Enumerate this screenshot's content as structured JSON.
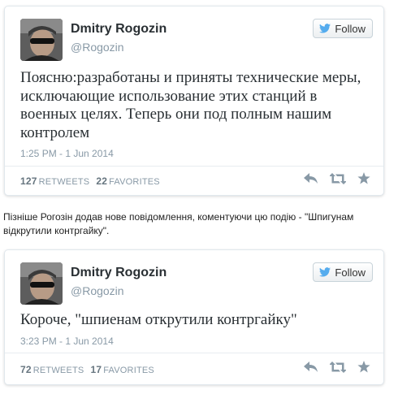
{
  "colors": {
    "brand_blue": "#55acee",
    "secondary_text": "#8899a6",
    "primary_text": "#292f33",
    "action_icon": "#8899a6"
  },
  "icons": [
    "avatar-photo",
    "twitter-bird-icon",
    "reply-icon",
    "retweet-icon",
    "favorite-star-icon"
  ],
  "tweets": [
    {
      "author_name": "Dmitry Rogozin",
      "author_handle": "@Rogozin",
      "follow_label": "Follow",
      "text": "Поясню:разработаны и приняты технические меры, исключающие использование этих станций в военных целях. Теперь они под полным нашим контролем",
      "timestamp": "1:25 PM - 1 Jun 2014",
      "retweets_count": "127",
      "retweets_label": "RETWEETS",
      "favorites_count": "22",
      "favorites_label": "FAVORITES"
    },
    {
      "author_name": "Dmitry Rogozin",
      "author_handle": "@Rogozin",
      "follow_label": "Follow",
      "text": "Короче, \"шпиенам открутили контргайку\"",
      "timestamp": "3:23 PM - 1 Jun 2014",
      "retweets_count": "72",
      "retweets_label": "RETWEETS",
      "favorites_count": "17",
      "favorites_label": "FAVORITES"
    }
  ],
  "caption": "Пізніше Рогозін додав нове повідомлення, коментуючи цю подію - \"Шпигунам відкрутили контргайку\"."
}
